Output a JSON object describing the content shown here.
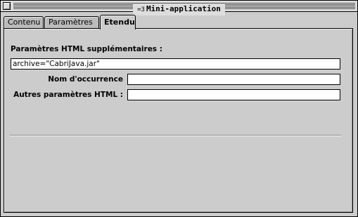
{
  "window": {
    "title": "Mini-application",
    "title_icon": "=3"
  },
  "tabs": [
    {
      "label": "Contenu",
      "active": false
    },
    {
      "label": "Paramètres",
      "active": false
    },
    {
      "label": "Etendu",
      "active": true
    }
  ],
  "panel": {
    "html_params_label": "Paramètres HTML supplémentaires :",
    "html_params_value": "archive=\"CabriJava.jar\"",
    "occurrence_label": "Nom d'occurrence",
    "occurrence_value": "",
    "other_html_label": "Autres paramètres HTML :",
    "other_html_value": ""
  },
  "icons": {
    "close": "close-box-icon",
    "app": "applet-icon"
  }
}
